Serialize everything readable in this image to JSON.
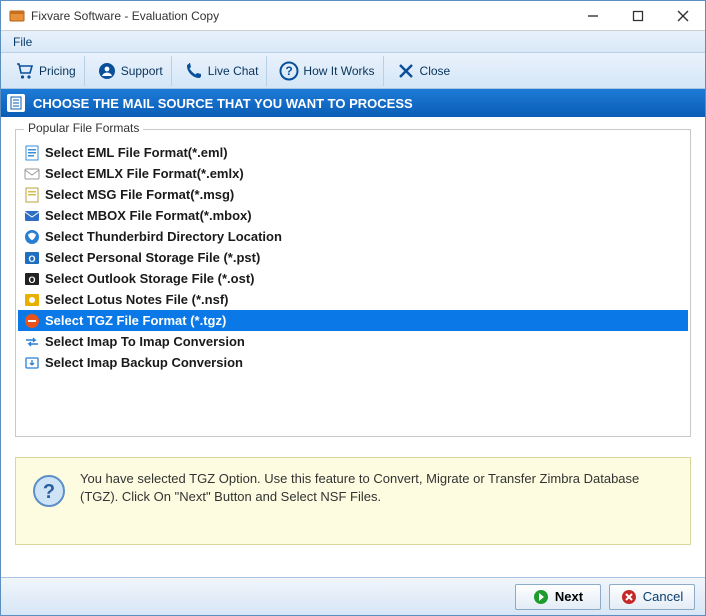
{
  "window": {
    "title": "Fixvare Software - Evaluation Copy"
  },
  "menubar": {
    "file": "File"
  },
  "toolbar": {
    "pricing": "Pricing",
    "support": "Support",
    "livechat": "Live Chat",
    "howitworks": "How It Works",
    "close": "Close"
  },
  "header": {
    "title": "CHOOSE THE MAIL SOURCE THAT YOU WANT TO PROCESS"
  },
  "group": {
    "legend": "Popular File Formats"
  },
  "formats": {
    "eml": "Select EML File Format(*.eml)",
    "emlx": "Select EMLX File Format(*.emlx)",
    "msg": "Select MSG File Format(*.msg)",
    "mbox": "Select MBOX File Format(*.mbox)",
    "tbird": "Select Thunderbird Directory Location",
    "pst": "Select Personal Storage File (*.pst)",
    "ost": "Select Outlook Storage File (*.ost)",
    "nsf": "Select Lotus Notes File (*.nsf)",
    "tgz": "Select TGZ File Format (*.tgz)",
    "imap2": "Select Imap To Imap Conversion",
    "imapb": "Select Imap Backup Conversion"
  },
  "selected_format": "tgz",
  "info": {
    "text": "You have selected TGZ Option. Use this feature to Convert, Migrate or Transfer Zimbra Database (TGZ). Click On \"Next\" Button and Select NSF Files."
  },
  "footer": {
    "next": "Next",
    "cancel": "Cancel"
  }
}
